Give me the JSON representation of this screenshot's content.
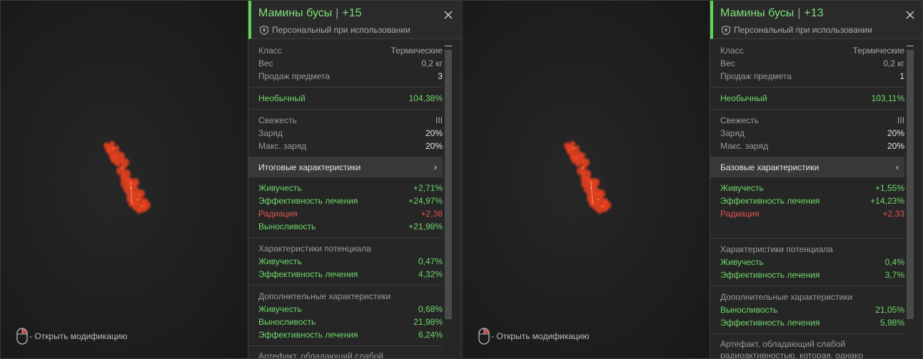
{
  "left": {
    "title": "Мамины бусы",
    "sep": "|",
    "level": "+15",
    "subtitle": "Персональный при использовании",
    "hint": "- Открыть модификацию",
    "info": [
      {
        "label": "Класс",
        "value": "Термические"
      },
      {
        "label": "Вес",
        "value": "0,2 кг"
      },
      {
        "label": "Продаж предмета",
        "value": "3"
      }
    ],
    "rarity": {
      "label": "Необычный",
      "value": "104,38%"
    },
    "condition": [
      {
        "label": "Свежесть",
        "value": "III"
      },
      {
        "label": "Заряд",
        "value": "20%"
      },
      {
        "label": "Макс. заряд",
        "value": "20%"
      }
    ],
    "tab": {
      "label": "Итоговые характеристики",
      "arrow": "›"
    },
    "stats": [
      {
        "label": "Живучесть",
        "value": "+2,71%",
        "color": "green"
      },
      {
        "label": "Эффективность лечения",
        "value": "+24,97%",
        "color": "green"
      },
      {
        "label": "Радиация",
        "value": "+2,36",
        "color": "red"
      },
      {
        "label": "Выносливость",
        "value": "+21,98%",
        "color": "green"
      }
    ],
    "potential": {
      "title": "Характеристики потенциала",
      "rows": [
        {
          "label": "Живучесть",
          "value": "0,47%"
        },
        {
          "label": "Эффективность лечения",
          "value": "4,32%"
        }
      ]
    },
    "extra": {
      "title": "Дополнительные характеристики",
      "rows": [
        {
          "label": "Живучесть",
          "value": "0,68%"
        },
        {
          "label": "Выносливость",
          "value": "21,98%"
        },
        {
          "label": "Эффективность лечения",
          "value": "6,24%"
        }
      ]
    },
    "description": "Артефакт, обладающий слабой"
  },
  "right": {
    "title": "Мамины бусы",
    "sep": "|",
    "level": "+13",
    "subtitle": "Персональный при использовании",
    "hint": "- Открыть модификацию",
    "info": [
      {
        "label": "Класс",
        "value": "Термические"
      },
      {
        "label": "Вес",
        "value": "0,2 кг"
      },
      {
        "label": "Продаж предмета",
        "value": "1"
      }
    ],
    "rarity": {
      "label": "Необычный",
      "value": "103,11%"
    },
    "condition": [
      {
        "label": "Свежесть",
        "value": "III"
      },
      {
        "label": "Заряд",
        "value": "20%"
      },
      {
        "label": "Макс. заряд",
        "value": "20%"
      }
    ],
    "tab": {
      "label": "Базовые характеристики",
      "arrow": "‹"
    },
    "stats": [
      {
        "label": "Живучесть",
        "value": "+1,55%",
        "color": "green"
      },
      {
        "label": "Эффективность лечения",
        "value": "+14,23%",
        "color": "green"
      },
      {
        "label": "Радиация",
        "value": "+2,33",
        "color": "red"
      }
    ],
    "potential": {
      "title": "Характеристики потенциала",
      "rows": [
        {
          "label": "Живучесть",
          "value": "0,4%"
        },
        {
          "label": "Эффективность лечения",
          "value": "3,7%"
        }
      ]
    },
    "extra": {
      "title": "Дополнительные характеристики",
      "rows": [
        {
          "label": "Выносливость",
          "value": "21,05%"
        },
        {
          "label": "Эффективность лечения",
          "value": "5,98%"
        }
      ]
    },
    "description": "Артефакт, обладающий слабой радиоактивностью, которая, однако"
  },
  "colors": {
    "green": "#6fd86a",
    "red": "#e05555",
    "accent": "#5fd65a",
    "artifact": "#e8401c"
  }
}
